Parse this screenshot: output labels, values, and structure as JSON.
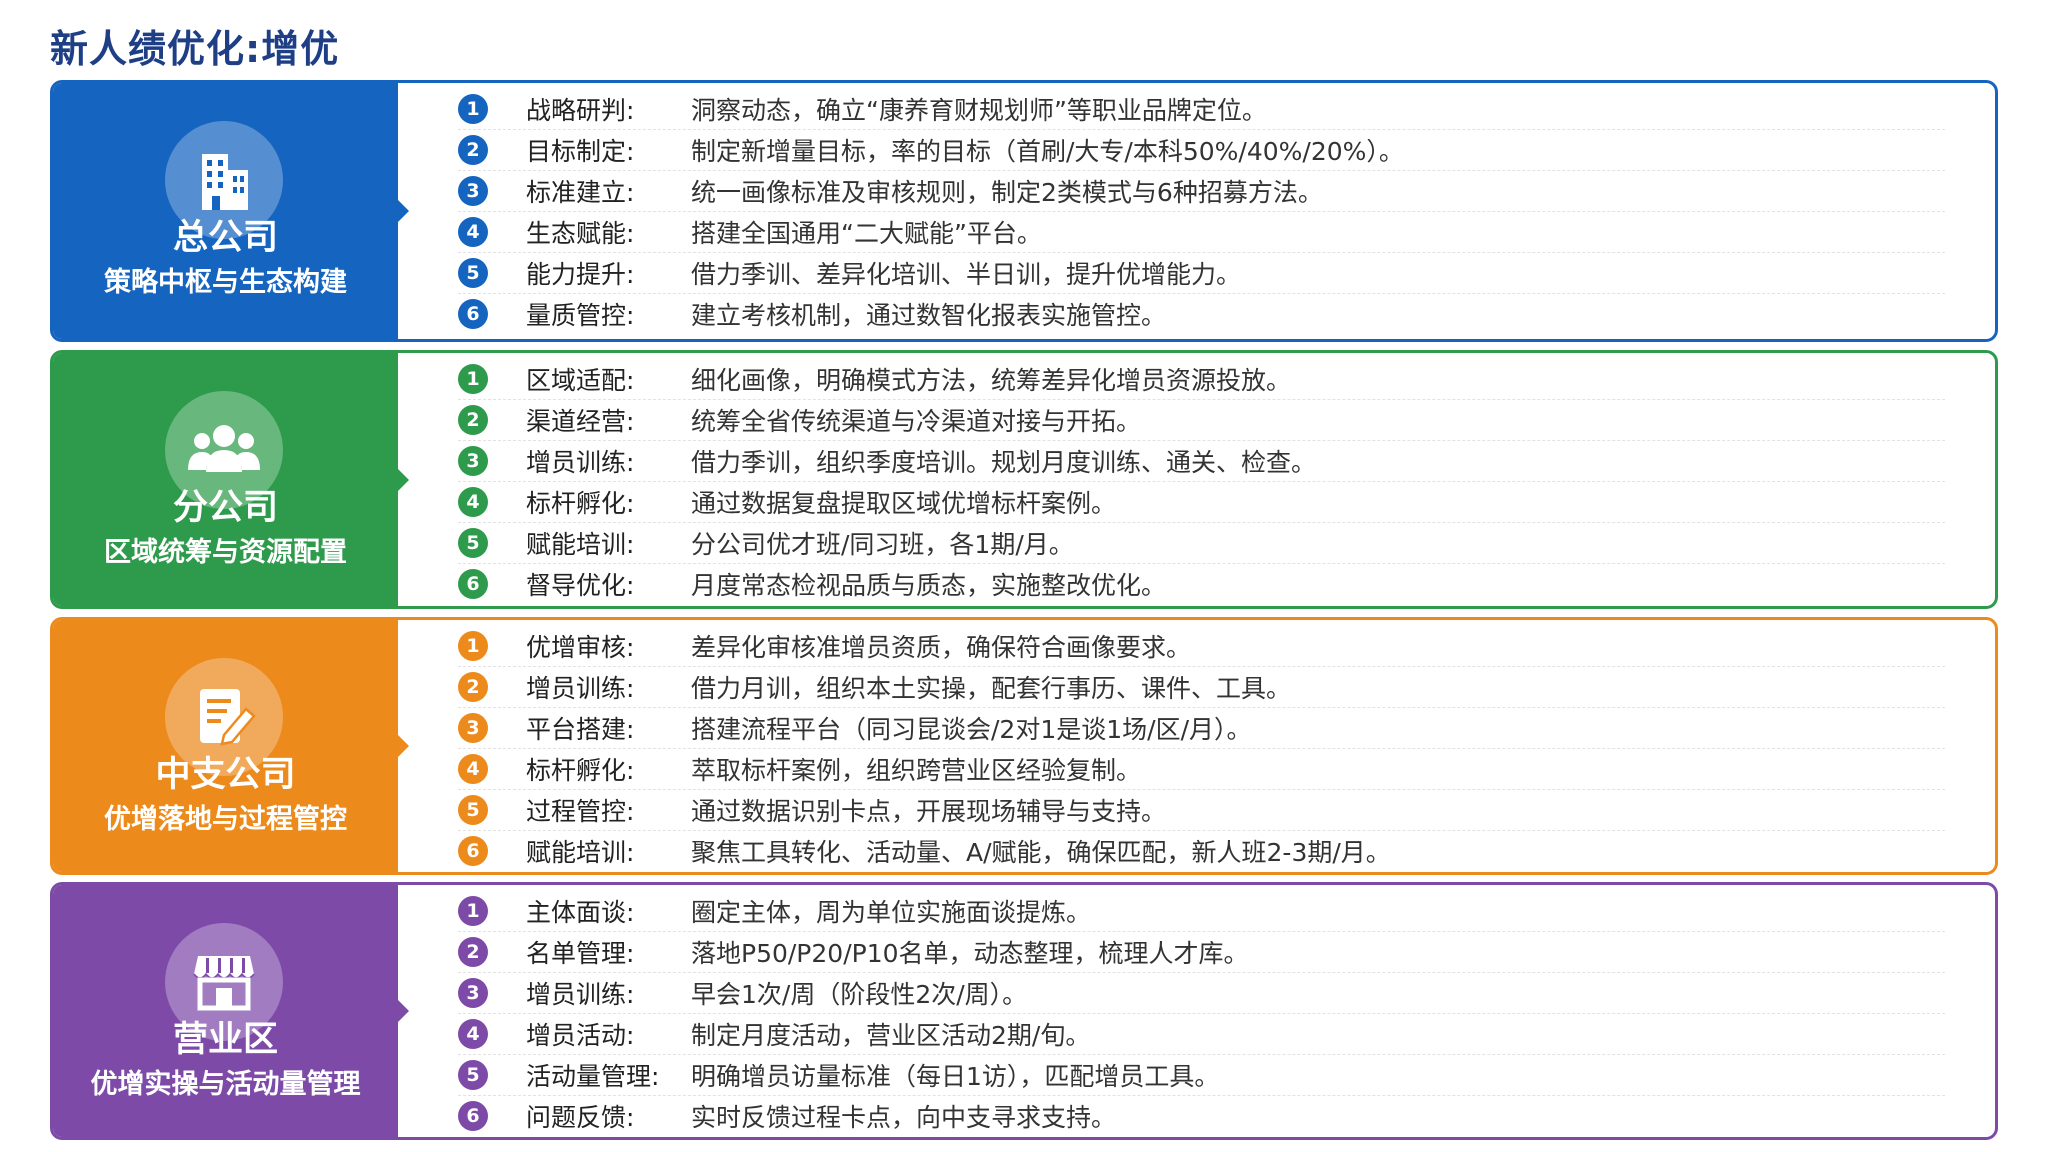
{
  "page_title": "新人绩优化:增优",
  "sections": [
    {
      "color": "#1565c0",
      "title": "总公司",
      "subtitle": "策略中枢与生态构建",
      "icon": "building-icon",
      "items": [
        {
          "num": "1",
          "label": "战略研判:",
          "text": "洞察动态，确立“康养育财规划师”等职业品牌定位。"
        },
        {
          "num": "2",
          "label": "目标制定:",
          "text": "制定新增量目标，率的目标（首刷/大专/本科50%/40%/20%）。"
        },
        {
          "num": "3",
          "label": "标准建立:",
          "text": "统一画像标准及审核规则，制定2类模式与6种招募方法。"
        },
        {
          "num": "4",
          "label": "生态赋能:",
          "text": "搭建全国通用“二大赋能”平台。"
        },
        {
          "num": "5",
          "label": "能力提升:",
          "text": "借力季训、差异化培训、半日训，提升优增能力。"
        },
        {
          "num": "6",
          "label": "量质管控:",
          "text": "建立考核机制，通过数智化报表实施管控。"
        }
      ]
    },
    {
      "color": "#2e9b4c",
      "title": "分公司",
      "subtitle": "区域统筹与资源配置",
      "icon": "people-icon",
      "items": [
        {
          "num": "1",
          "label": "区域适配:",
          "text": "细化画像，明确模式方法，统筹差异化增员资源投放。"
        },
        {
          "num": "2",
          "label": "渠道经营:",
          "text": "统筹全省传统渠道与冷渠道对接与开拓。"
        },
        {
          "num": "3",
          "label": "增员训练:",
          "text": "借力季训，组织季度培训。规划月度训练、通关、检查。"
        },
        {
          "num": "4",
          "label": "标杆孵化:",
          "text": "通过数据复盘提取区域优增标杆案例。"
        },
        {
          "num": "5",
          "label": "赋能培训:",
          "text": "分公司优才班/同习班，各1期/月。"
        },
        {
          "num": "6",
          "label": "督导优化:",
          "text": "月度常态检视品质与质态，实施整改优化。"
        }
      ]
    },
    {
      "color": "#ec8a1c",
      "title": "中支公司",
      "subtitle": "优增落地与过程管控",
      "icon": "document-edit-icon",
      "items": [
        {
          "num": "1",
          "label": "优增审核:",
          "text": "差异化审核准增员资质，确保符合画像要求。"
        },
        {
          "num": "2",
          "label": "增员训练:",
          "text": "借力月训，组织本土实操，配套行事历、课件、工具。"
        },
        {
          "num": "3",
          "label": "平台搭建:",
          "text": "搭建流程平台（同习昆谈会/2对1是谈1场/区/月）。"
        },
        {
          "num": "4",
          "label": "标杆孵化:",
          "text": "萃取标杆案例，组织跨营业区经验复制。"
        },
        {
          "num": "5",
          "label": "过程管控:",
          "text": "通过数据识别卡点，开展现场辅导与支持。"
        },
        {
          "num": "6",
          "label": "赋能培训:",
          "text": "聚焦工具转化、活动量、A/赋能，确保匹配，新人班2-3期/月。"
        }
      ]
    },
    {
      "color": "#7d4aa8",
      "title": "营业区",
      "subtitle": "优增实操与活动量管理",
      "icon": "store-icon",
      "items": [
        {
          "num": "1",
          "label": "主体面谈:",
          "text": "圈定主体，周为单位实施面谈提炼。"
        },
        {
          "num": "2",
          "label": "名单管理:",
          "text": "落地P50/P20/P10名单，动态整理，梳理人才库。"
        },
        {
          "num": "3",
          "label": "增员训练:",
          "text": "早会1次/周（阶段性2次/周）。"
        },
        {
          "num": "4",
          "label": "增员活动:",
          "text": "制定月度活动，营业区活动2期/旬。"
        },
        {
          "num": "5",
          "label": "活动量管理:",
          "text": "明确增员访量标准（每日1访），匹配增员工具。"
        },
        {
          "num": "6",
          "label": "问题反馈:",
          "text": "实时反馈过程卡点，向中支寻求支持。"
        }
      ]
    }
  ]
}
